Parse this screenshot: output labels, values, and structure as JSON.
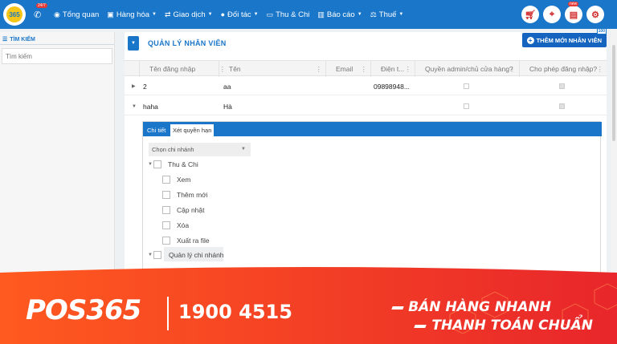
{
  "topbar": {
    "logo_text": "365",
    "hotline_badge": "24/7",
    "nav": [
      {
        "icon": "dashboard-icon",
        "label": "Tổng quan",
        "caret": false
      },
      {
        "icon": "box-icon",
        "label": "Hàng hóa",
        "caret": true
      },
      {
        "icon": "exchange-icon",
        "label": "Giao dịch",
        "caret": true
      },
      {
        "icon": "partners-icon",
        "label": "Đối tác",
        "caret": true
      },
      {
        "icon": "money-icon",
        "label": "Thu & Chi",
        "caret": false
      },
      {
        "icon": "chart-icon",
        "label": "Báo cáo",
        "caret": true
      },
      {
        "icon": "scale-icon",
        "label": "Thuế",
        "caret": true
      }
    ],
    "right_icons": [
      "cart-icon",
      "location-icon",
      "gift-icon",
      "settings-icon"
    ],
    "gift_badge": "new"
  },
  "sidebar": {
    "title": "TÌM KIẾM",
    "search_placeholder": "Tìm kiếm"
  },
  "main": {
    "title": "QUẢN LÝ NHÂN VIÊN",
    "add_button": "THÊM MỚI NHÂN VIÊN",
    "add_badge": "100"
  },
  "table": {
    "columns": [
      "Tên đăng nhập",
      "Tên",
      "Email",
      "Điện t...",
      "Quyền admin/chủ cửa hàng?",
      "Cho phép đăng nhập?"
    ],
    "rows": [
      {
        "username": "2",
        "name": "aa",
        "email": "",
        "phone": "09898948...",
        "admin": false,
        "login_allowed": true,
        "expanded": false
      },
      {
        "username": "haha",
        "name": "Hà",
        "email": "",
        "phone": "",
        "admin": false,
        "login_allowed": true,
        "expanded": true
      }
    ]
  },
  "detail": {
    "tabs": [
      "Chi tiết",
      "Xét quyền hạn"
    ],
    "active_tab": 1,
    "branch_select": "Chọn chi nhánh",
    "tree": {
      "group1": "Thu & Chi",
      "children": [
        "Xem",
        "Thêm mới",
        "Cập nhật",
        "Xóa",
        "Xuất ra file"
      ],
      "group2": "Quản lý chi nhánh"
    }
  },
  "banner": {
    "brand": "POS365",
    "phone": "1900 4515",
    "slogan1": "BÁN HÀNG NHANH",
    "slogan2": "THANH TOÁN CHUẨN",
    "colors": {
      "start": "#ff5a1f",
      "end": "#e8262b"
    }
  }
}
